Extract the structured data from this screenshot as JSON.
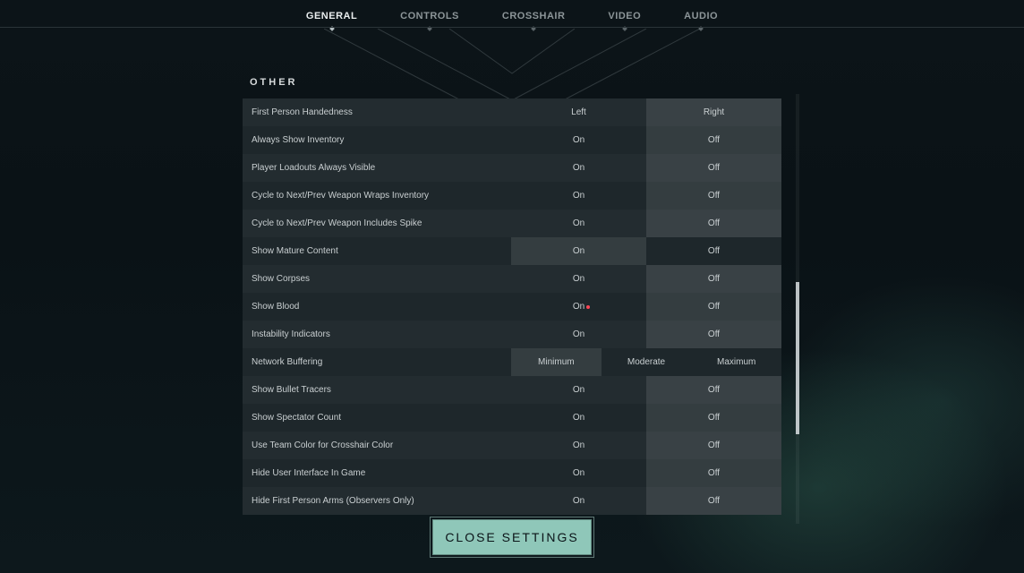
{
  "tabs": [
    {
      "label": "GENERAL",
      "active": true
    },
    {
      "label": "CONTROLS",
      "active": false
    },
    {
      "label": "CROSSHAIR",
      "active": false
    },
    {
      "label": "VIDEO",
      "active": false
    },
    {
      "label": "AUDIO",
      "active": false
    }
  ],
  "section_title": "OTHER",
  "rows": [
    {
      "label": "First Person Handedness",
      "options": [
        "Left",
        "Right"
      ],
      "selected": "Right"
    },
    {
      "label": "Always Show Inventory",
      "options": [
        "On",
        "Off"
      ],
      "selected": "Off"
    },
    {
      "label": "Player Loadouts Always Visible",
      "options": [
        "On",
        "Off"
      ],
      "selected": "Off"
    },
    {
      "label": "Cycle to Next/Prev Weapon Wraps Inventory",
      "options": [
        "On",
        "Off"
      ],
      "selected": "Off"
    },
    {
      "label": "Cycle to Next/Prev Weapon Includes Spike",
      "options": [
        "On",
        "Off"
      ],
      "selected": "Off"
    },
    {
      "label": "Show Mature Content",
      "options": [
        "On",
        "Off"
      ],
      "selected": "On"
    },
    {
      "label": "Show Corpses",
      "options": [
        "On",
        "Off"
      ],
      "selected": "Off"
    },
    {
      "label": "Show Blood",
      "options": [
        "On",
        "Off"
      ],
      "selected": "Off",
      "dot": "On"
    },
    {
      "label": "Instability Indicators",
      "options": [
        "On",
        "Off"
      ],
      "selected": "Off"
    },
    {
      "label": "Network Buffering",
      "options": [
        "Minimum",
        "Moderate",
        "Maximum"
      ],
      "selected": "Minimum"
    },
    {
      "label": "Show Bullet Tracers",
      "options": [
        "On",
        "Off"
      ],
      "selected": "Off"
    },
    {
      "label": "Show Spectator Count",
      "options": [
        "On",
        "Off"
      ],
      "selected": "Off"
    },
    {
      "label": "Use Team Color for Crosshair Color",
      "options": [
        "On",
        "Off"
      ],
      "selected": "Off"
    },
    {
      "label": "Hide User Interface In Game",
      "options": [
        "On",
        "Off"
      ],
      "selected": "Off"
    },
    {
      "label": "Hide First Person Arms (Observers Only)",
      "options": [
        "On",
        "Off"
      ],
      "selected": "Off"
    }
  ],
  "close_label": "CLOSE SETTINGS"
}
